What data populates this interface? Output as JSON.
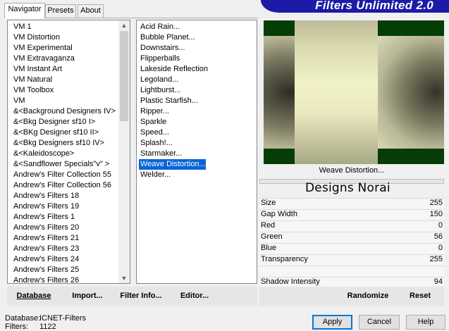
{
  "tabs": [
    {
      "label": "Navigator",
      "active": true
    },
    {
      "label": "Presets",
      "active": false
    },
    {
      "label": "About",
      "active": false
    }
  ],
  "banner": {
    "title": "Filters Unlimited 2.0",
    "color": "#1b1ba8"
  },
  "categories": {
    "items": [
      "VM 1",
      "VM Distortion",
      "VM Experimental",
      "VM Extravaganza",
      "VM Instant Art",
      "VM Natural",
      "VM Toolbox",
      "VM",
      "&<Background Designers IV>",
      "&<Bkg Designer sf10 I>",
      "&<BKg Designer sf10 II>",
      "&<Bkg Designers sf10 IV>",
      "&<Kaleidoscope>",
      "&<Sandflower Specials\"v\" >",
      "Andrew's Filter Collection 55",
      "Andrew's Filter Collection 56",
      "Andrew's Filters 18",
      "Andrew's Filters 19",
      "Andrew's Filters 1",
      "Andrew's Filters 20",
      "Andrew's Filters 21",
      "Andrew's Filters 23",
      "Andrew's Filters 24",
      "Andrew's Filters 25",
      "Andrew's Filters 26"
    ]
  },
  "filters": {
    "items": [
      "Acid Rain...",
      "Bubble Planet...",
      "Downstairs...",
      "Flipperballs",
      "Lakeside Reflection",
      "Legoland...",
      "Lightburst...",
      "Plastic Starfish...",
      "Ripper...",
      "Sparkle",
      "Speed...",
      "Splash!...",
      "Starmaker...",
      "Weave Distortion...",
      "Welder..."
    ],
    "selected_index": 13
  },
  "preview": {
    "filter_name": "Weave Distortion...",
    "logo_text": "Designs Norai"
  },
  "parameters": [
    {
      "label": "Size",
      "value": "255"
    },
    {
      "label": "Gap Width",
      "value": "150"
    },
    {
      "label": "Red",
      "value": "0"
    },
    {
      "label": "Green",
      "value": "56"
    },
    {
      "label": "Blue",
      "value": "0"
    },
    {
      "label": "Transparency",
      "value": "255"
    },
    {
      "label": "",
      "value": ""
    },
    {
      "label": "Shadow Intensity",
      "value": "94"
    }
  ],
  "toolbar": {
    "database": "Database",
    "import": "Import...",
    "filter_info": "Filter Info...",
    "editor": "Editor...",
    "randomize": "Randomize",
    "reset": "Reset"
  },
  "status": {
    "database_label": "Database:",
    "database_value": "ICNET-Filters",
    "filters_label": "Filters:",
    "filters_value": "1122"
  },
  "buttons": {
    "apply": "Apply",
    "cancel": "Cancel",
    "help": "Help"
  },
  "colors": {
    "selection": "#0a64d8",
    "preview_bg": "#063d06"
  }
}
